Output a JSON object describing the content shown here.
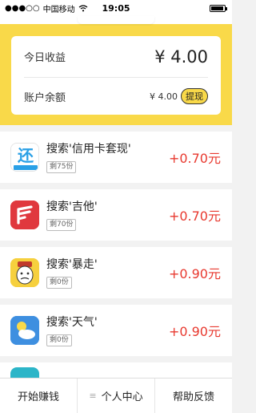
{
  "status": {
    "carrier": "中国移动",
    "time": "19:05"
  },
  "summary": {
    "today_label": "今日收益",
    "today_amount": "¥ 4.00",
    "balance_label": "账户余额",
    "balance_amount": "¥ 4.00",
    "withdraw_label": "提现"
  },
  "tasks": [
    {
      "title": "搜索'信用卡套现'",
      "remaining": "剩75份",
      "reward": "+0.70元",
      "icon": "huan-app-icon",
      "icon_color": "#3aa4e8"
    },
    {
      "title": "搜索'吉他'",
      "remaining": "剩70份",
      "reward": "+0.70元",
      "icon": "guitar-app-icon",
      "icon_color": "#e0383e"
    },
    {
      "title": "搜索'暴走'",
      "remaining": "剩0份",
      "reward": "+0.90元",
      "icon": "baozou-app-icon",
      "icon_color": "#f5c43a"
    },
    {
      "title": "搜索'天气'",
      "remaining": "剩0份",
      "reward": "+0.90元",
      "icon": "weather-app-icon",
      "icon_color": "#3e8fe0"
    }
  ],
  "tabs": {
    "start": "开始赚钱",
    "profile": "个人中心",
    "help": "帮助反馈"
  },
  "colors": {
    "brand_yellow": "#f9d949",
    "reward_red": "#e8392f"
  }
}
